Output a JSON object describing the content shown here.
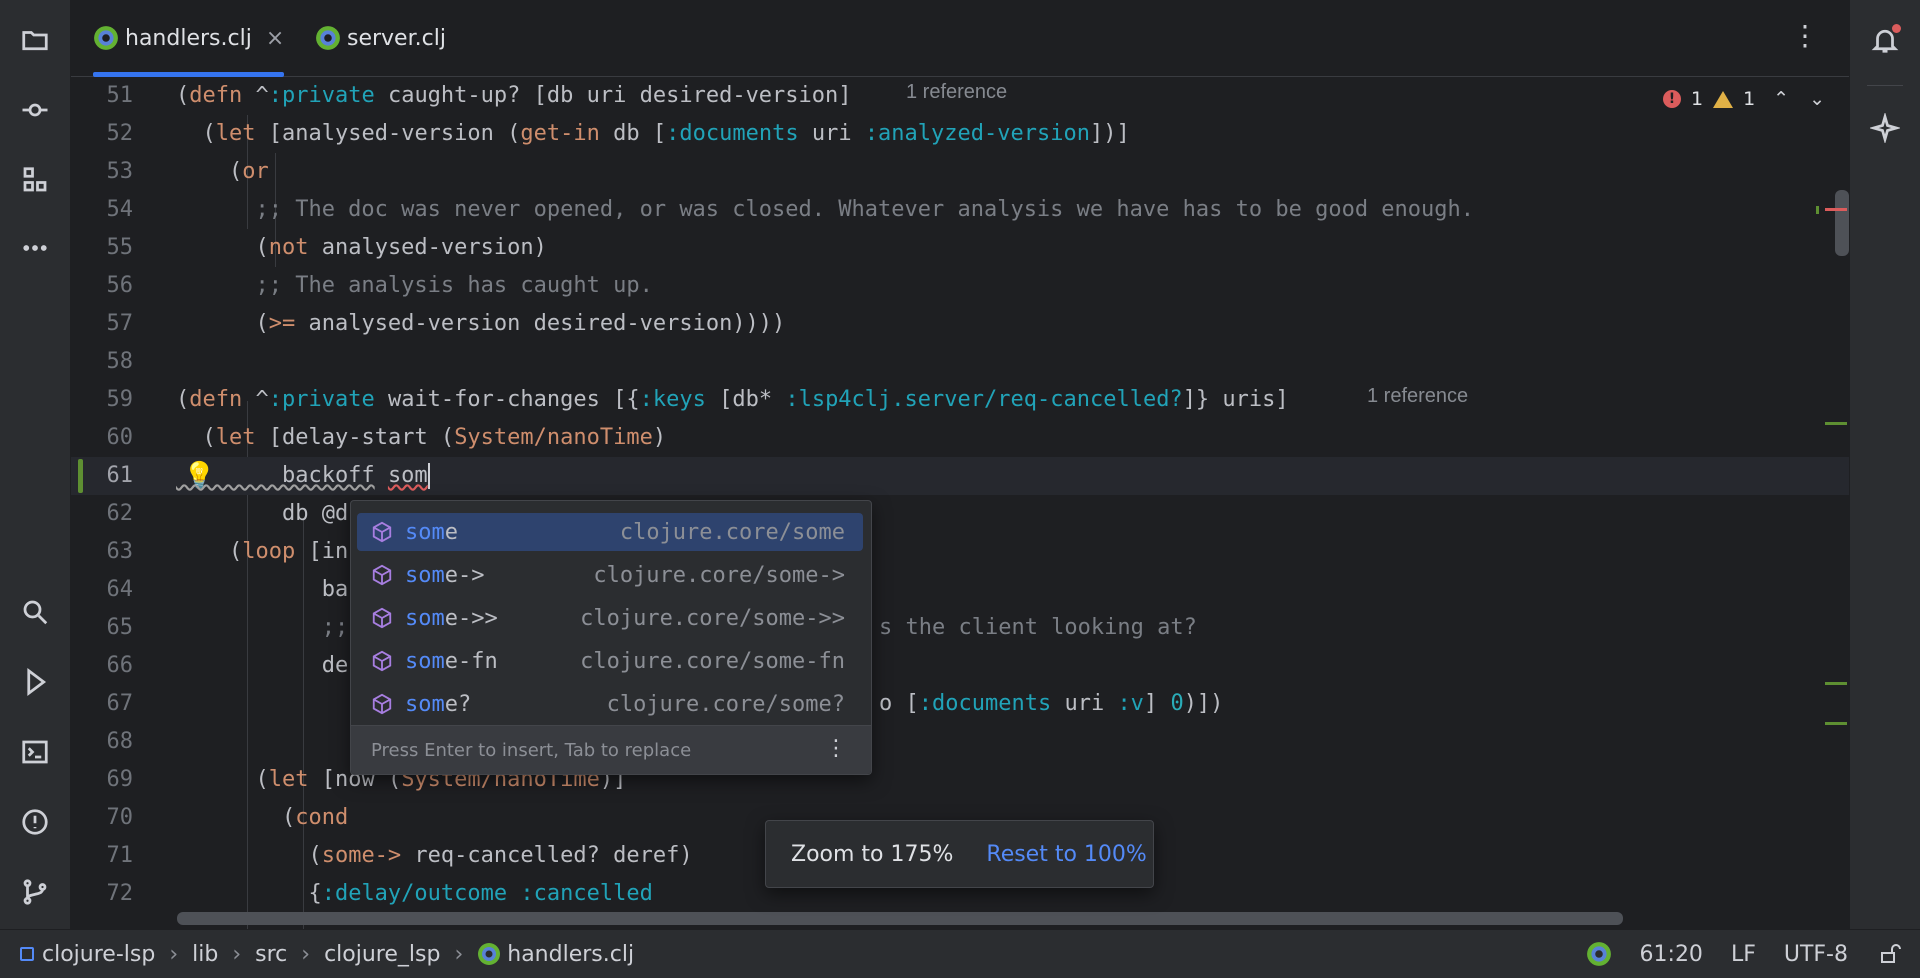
{
  "tabs": [
    {
      "label": "handlers.clj",
      "active": true
    },
    {
      "label": "server.clj",
      "active": false
    }
  ],
  "tab_close": "×",
  "inspection": {
    "errors": "1",
    "warnings": "1"
  },
  "lines": [
    {
      "n": "51"
    },
    {
      "n": "52"
    },
    {
      "n": "53"
    },
    {
      "n": "54"
    },
    {
      "n": "55"
    },
    {
      "n": "56"
    },
    {
      "n": "57"
    },
    {
      "n": "58"
    },
    {
      "n": "59"
    },
    {
      "n": "60"
    },
    {
      "n": "61"
    },
    {
      "n": "62"
    },
    {
      "n": "63"
    },
    {
      "n": "64"
    },
    {
      "n": "65"
    },
    {
      "n": "66"
    },
    {
      "n": "67"
    },
    {
      "n": "68"
    },
    {
      "n": "69"
    },
    {
      "n": "70"
    },
    {
      "n": "71"
    },
    {
      "n": "72"
    }
  ],
  "code": {
    "l51a": "(",
    "l51b": "defn",
    "l51c": " ^",
    "l51d": ":private",
    "l51e": " caught-up? [db uri desired-version]",
    "l51ref": "1 reference",
    "l52a": "  (",
    "l52b": "let",
    "l52c": " [analysed-version (",
    "l52d": "get-in",
    "l52e": " db [",
    "l52f": ":documents",
    "l52g": " uri ",
    "l52h": ":analyzed-version",
    "l52i": "])]",
    "l53a": "    (",
    "l53b": "or",
    "l54": "      ;; The doc was never opened, or was closed. Whatever analysis we have has to be good enough.",
    "l55a": "      (",
    "l55b": "not",
    "l55c": " analysed-version)",
    "l56": "      ;; The analysis has caught up.",
    "l57a": "      (",
    "l57b": ">=",
    "l57c": " analysed-version desired-version))))",
    "l59a": "(",
    "l59b": "defn",
    "l59c": " ^",
    "l59d": ":private",
    "l59e": " wait-for-changes [{",
    "l59f": ":keys",
    "l59g": " [db* ",
    "l59h": ":lsp4clj.server/req-cancelled?",
    "l59i": "]} uris]",
    "l59ref": "1 reference",
    "l60a": "  (",
    "l60b": "let",
    "l60c": " [delay-start (",
    "l60d": "System/nanoTime",
    "l60e": ")",
    "l61a": "        backoff",
    "l61b": " ",
    "l61c": "som",
    "l62": "        db @d",
    "l63a": "    (",
    "l63b": "loop",
    "l63c": " [in",
    "l64": "           ba",
    "l65a": "           ;;",
    "l65b": "s the client looking at?",
    "l66": "           de",
    "l67a": "o [",
    "l67b": ":documents",
    "l67c": " uri ",
    "l67d": ":v",
    "l67e": "] ",
    "l67f": "0",
    "l67g": ")])",
    "l69a": "      (",
    "l69b": "let",
    "l69c": " [now (",
    "l69d": "System/nanoTime",
    "l69e": ")]",
    "l70a": "        (",
    "l70b": "cond",
    "l71a": "          (",
    "l71b": "some->",
    "l71c": " req-cancelled? deref)",
    "l72a": "          {",
    "l72b": ":delay/outcome",
    "l72c": " ",
    "l72d": ":cancelled"
  },
  "completion": {
    "typed": "som",
    "items": [
      {
        "rest": "e",
        "ns": "clojure.core/some"
      },
      {
        "rest": "e->",
        "ns": "clojure.core/some->"
      },
      {
        "rest": "e->>",
        "ns": "clojure.core/some->>"
      },
      {
        "rest": "e-fn",
        "ns": "clojure.core/some-fn"
      },
      {
        "rest": "e?",
        "ns": "clojure.core/some?"
      }
    ],
    "footer": "Press Enter to insert, Tab to replace"
  },
  "zoom": {
    "label": "Zoom to 175%",
    "reset": "Reset to 100%"
  },
  "breadcrumbs": [
    "clojure-lsp",
    "lib",
    "src",
    "clojure_lsp",
    "handlers.clj"
  ],
  "status": {
    "position": "61:20",
    "line_sep": "LF",
    "encoding": "UTF-8"
  },
  "colors": {
    "accent": "#3574f0",
    "link": "#548af7",
    "keyword": "#cf8e6d",
    "clj_keyword": "#21a3b8"
  },
  "icons": {
    "project": "folder-icon",
    "commit": "commit-icon",
    "structure": "structure-icon",
    "more": "more-icon",
    "search": "search-icon",
    "run": "run-icon",
    "terminal": "terminal-icon",
    "problems": "problems-icon",
    "git": "git-branch-icon",
    "notifications": "bell-icon",
    "ai": "ai-sparkle-icon"
  }
}
